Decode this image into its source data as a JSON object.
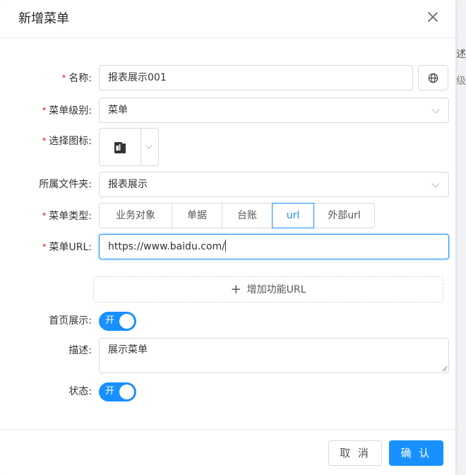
{
  "background": {
    "text1": "述",
    "text2": "级"
  },
  "modal": {
    "title": "新增菜单",
    "close_icon": "close-icon",
    "accent": "#1890ff",
    "required_color": "#f5222d"
  },
  "form": {
    "name": {
      "label": "名称:",
      "value": "报表展示001",
      "side_icon": "globe-icon"
    },
    "menu_level": {
      "label": "菜单级别:",
      "value": "菜单"
    },
    "icon_select": {
      "label": "选择图标:",
      "icon": "report-book-icon"
    },
    "folder": {
      "label": "所属文件夹:",
      "value": "报表展示"
    },
    "menu_type": {
      "label": "菜单类型:",
      "options": [
        "业务对象",
        "单据",
        "台账",
        "url",
        "外部url"
      ],
      "selected": "url"
    },
    "menu_url": {
      "label": "菜单URL:",
      "value": "https://www.baidu.com/"
    },
    "add_function_url": {
      "label": "增加功能URL"
    },
    "homepage_display": {
      "label": "首页展示:",
      "switch_text": "开",
      "on": true
    },
    "description": {
      "label": "描述:",
      "value": "展示菜单"
    },
    "status": {
      "label": "状态:",
      "switch_text": "开",
      "on": true
    }
  },
  "footer": {
    "cancel_label": "取 消",
    "ok_label": "确 认"
  }
}
